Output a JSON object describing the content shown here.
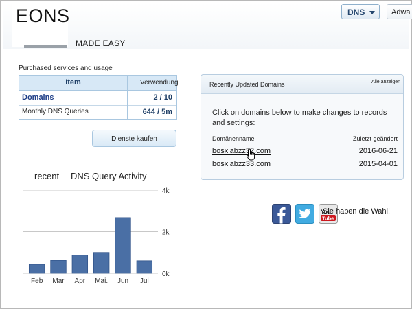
{
  "header": {
    "logo": "EONS",
    "tagline": "MADE EASY",
    "dns_button": "DNS",
    "advanced_button": "Adwa"
  },
  "services": {
    "title": "Purchased services and usage",
    "col_item": "Item",
    "col_usage": "Verwendung",
    "rows": [
      {
        "name": "Domains",
        "value": "2 / 10"
      },
      {
        "name": "Monthly DNS Queries",
        "value": "644 / 5m"
      }
    ],
    "buy_button": "Dienste kaufen"
  },
  "chart": {
    "title_part1": "recent",
    "title_part2": "DNS Query Activity"
  },
  "chart_data": {
    "type": "bar",
    "categories": [
      "Feb",
      "Mar",
      "Apr",
      "Mai.",
      "Jun",
      "Jul"
    ],
    "values": [
      430,
      620,
      870,
      1000,
      2680,
      600
    ],
    "ylim": [
      0,
      4000
    ],
    "yticks": [
      "0k",
      "2k",
      "4k"
    ],
    "grid": true,
    "bar_color": "#4a6fa5"
  },
  "recent_domains": {
    "title": "Recently Updated Domains",
    "view_all": "Alle anzeigen",
    "description": "Click on domains below to make changes to records and settings:",
    "col_name": "Domänenname",
    "col_date": "Zuletzt geändert",
    "domains": [
      {
        "name": "bosxlabzz32.com",
        "date": "2016-06-21"
      },
      {
        "name": "bosxlabzz33.com",
        "date": "2015-04-01"
      }
    ]
  },
  "social": {
    "text": "Sie haben die Wahl!",
    "icons": [
      "facebook-icon",
      "twitter-icon",
      "youtube-icon"
    ],
    "youtube_label": "You Tube"
  }
}
